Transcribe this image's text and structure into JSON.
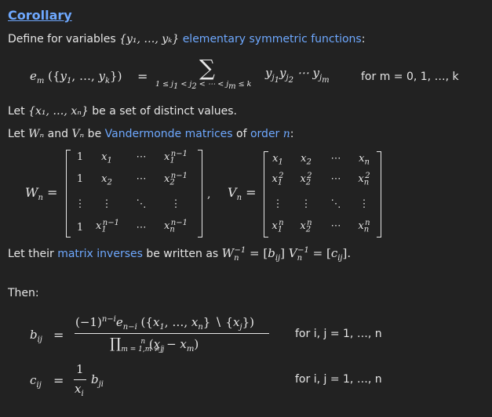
{
  "heading": "Corollary",
  "line_define": {
    "pre": "Define for variables ",
    "set": "{y₁, …, yₖ}",
    "link": "elementary symmetric functions",
    "post": ":"
  },
  "line_set_x": {
    "pre": "Let ",
    "set": "{x₁, …, xₙ}",
    "post": " be a set of distinct values."
  },
  "line_vander": {
    "pre": "Let ",
    "w": "Wₙ",
    "and": " and ",
    "v": "Vₙ",
    "be": " be ",
    "link1": "Vandermonde matrices",
    "of": " of ",
    "link2": "order",
    "n": " n",
    "post": ":"
  },
  "line_inverse": {
    "pre": "Let their ",
    "link1": "matrix",
    "link2": "inverses",
    "post": " be written as "
  },
  "then": "Then:",
  "cond1": "for m = 0, 1, …, k",
  "cond2": "for i, j = 1, …, n",
  "cond3": "for i, j = 1, …, n"
}
